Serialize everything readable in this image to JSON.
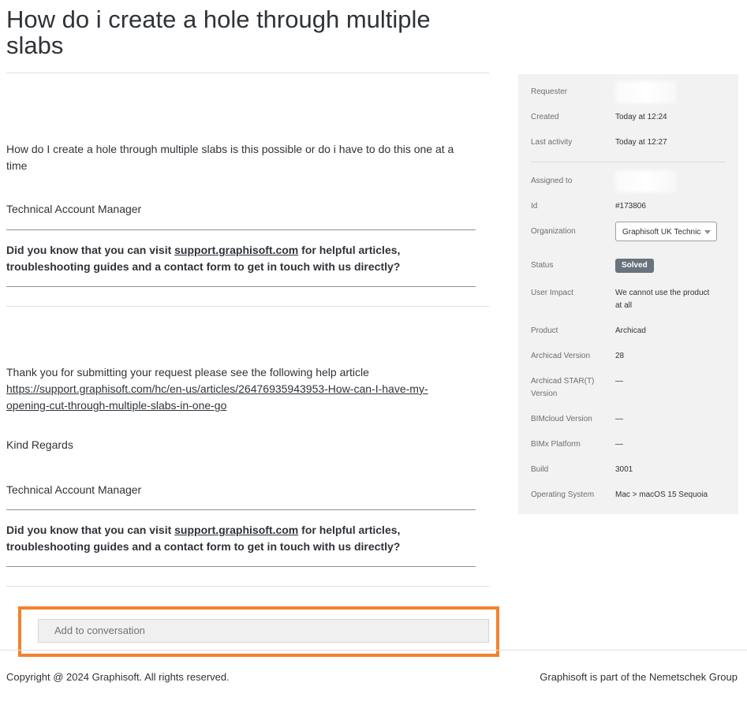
{
  "request": {
    "title": "How do i create a hole through multiple slabs"
  },
  "comments": [
    {
      "body": "How do I create a hole through multiple slabs is this possible or do i have to do this one at a time",
      "signature_role": "Technical Account Manager",
      "promo_prefix": "Did you know that you can visit ",
      "promo_link": "support.graphisoft.com",
      "promo_suffix": " for helpful articles, troubleshooting guides and a contact form to get in touch with us directly?"
    },
    {
      "body_intro": "Thank you for submitting your request please see the following help article",
      "article_link": "https://support.graphisoft.com/hc/en-us/articles/26476935943953-How-can-I-have-my-opening-cut-through-multiple-slabs-in-one-go",
      "closing": "Kind Regards",
      "signature_role": "Technical Account Manager",
      "promo_prefix": "Did you know that you can visit ",
      "promo_link": "support.graphisoft.com",
      "promo_suffix": " for helpful articles, troubleshooting guides and a contact form to get in touch with us directly?"
    }
  ],
  "comment_box": {
    "placeholder": "Add to conversation"
  },
  "sidebar": {
    "requester_label": "Requester",
    "created_label": "Created",
    "created_value": "Today at 12:24",
    "last_activity_label": "Last activity",
    "last_activity_value": "Today at 12:27",
    "assigned_label": "Assigned to",
    "id_label": "Id",
    "id_value": "#173806",
    "organization_label": "Organization",
    "organization_value": "Graphisoft UK Technical",
    "status_label": "Status",
    "status_value": "Solved",
    "user_impact_label": "User Impact",
    "user_impact_value": "We cannot use the product at all",
    "product_label": "Product",
    "product_value": "Archicad",
    "archicad_version_label": "Archicad Version",
    "archicad_version_value": "28",
    "star_version_label": "Archicad STAR(T) Version",
    "star_version_value": "—",
    "bimcloud_label": "BIMcloud Version",
    "bimcloud_value": "—",
    "bimx_label": "BIMx Platform",
    "bimx_value": "—",
    "build_label": "Build",
    "build_value": "3001",
    "os_label": "Operating System",
    "os_value": "Mac > macOS 15 Sequoia"
  },
  "footer": {
    "copyright": "Copyright @ 2024 Graphisoft. All rights reserved.",
    "group": "Graphisoft is part of the Nemetschek Group"
  },
  "colors": {
    "highlight": "#f5822a",
    "status_badge": "#68737d",
    "sidebar_bg": "#f2f2f2"
  }
}
